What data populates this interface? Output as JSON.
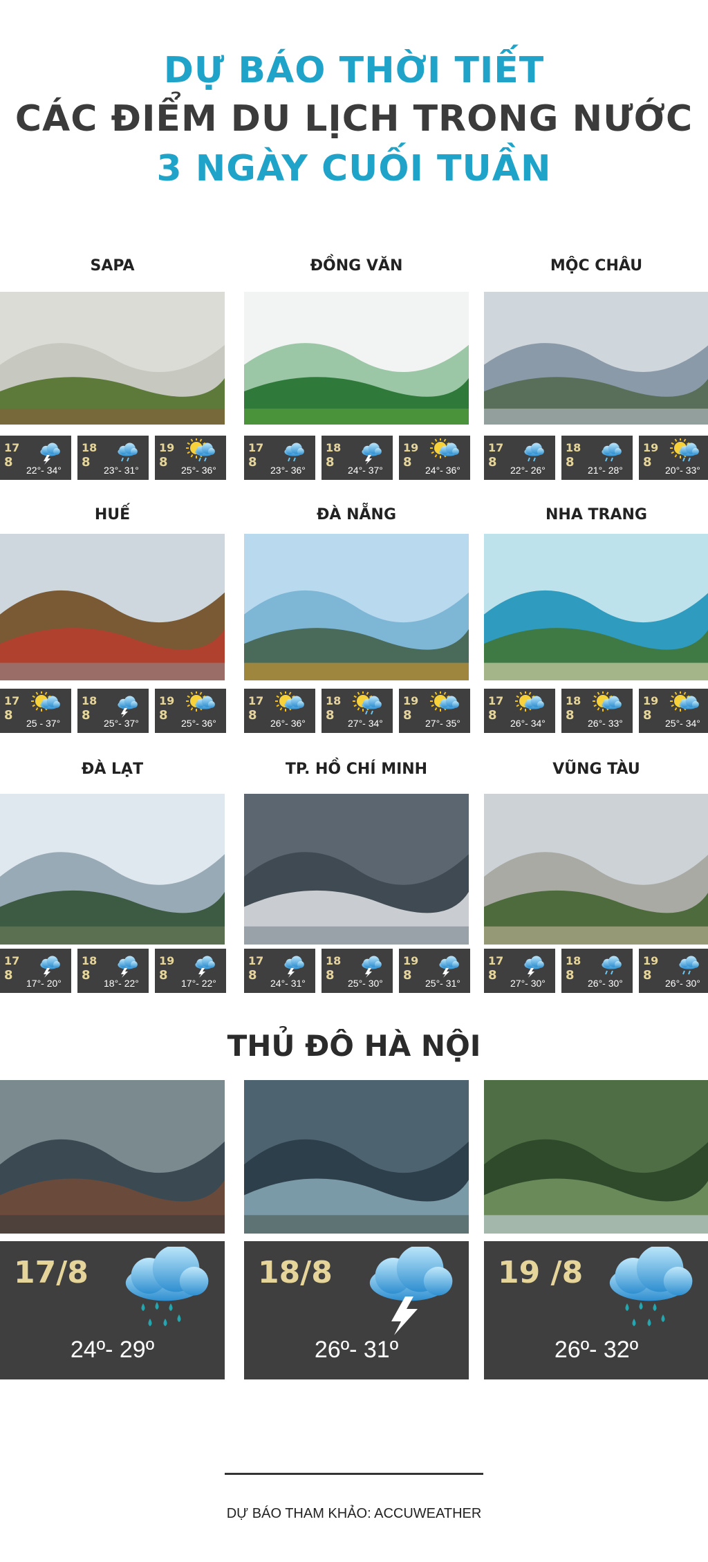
{
  "header": {
    "line1": "DỰ BÁO THỜI TIẾT",
    "line2": "CÁC ĐIỂM DU LỊCH TRONG NƯỚC",
    "line3": "3 NGÀY CUỐI TUẦN"
  },
  "cities": [
    {
      "name": "SAPA",
      "forecast": [
        {
          "day": "17",
          "month": "8",
          "temp": "22°- 34°",
          "icon": "storm-cloud-icon"
        },
        {
          "day": "18",
          "month": "8",
          "temp": "23°- 31°",
          "icon": "rain-cloud-icon"
        },
        {
          "day": "19",
          "month": "8",
          "temp": "25°- 36°",
          "icon": "sun-cloud-rain-icon"
        }
      ]
    },
    {
      "name": "ĐỒNG VĂN",
      "forecast": [
        {
          "day": "17",
          "month": "8",
          "temp": "23°- 36°",
          "icon": "rain-cloud-icon"
        },
        {
          "day": "18",
          "month": "8",
          "temp": "24°- 37°",
          "icon": "storm-cloud-icon"
        },
        {
          "day": "19",
          "month": "8",
          "temp": "24°- 36°",
          "icon": "sun-cloud-icon"
        }
      ]
    },
    {
      "name": "MỘC CHÂU",
      "forecast": [
        {
          "day": "17",
          "month": "8",
          "temp": "22°- 26°",
          "icon": "rain-cloud-icon"
        },
        {
          "day": "18",
          "month": "8",
          "temp": "21°- 28°",
          "icon": "rain-cloud-icon"
        },
        {
          "day": "19",
          "month": "8",
          "temp": "20°- 33°",
          "icon": "sun-cloud-rain-icon"
        }
      ]
    },
    {
      "name": "HUẾ",
      "forecast": [
        {
          "day": "17",
          "month": "8",
          "temp": "25 - 37°",
          "icon": "sun-cloud-icon"
        },
        {
          "day": "18",
          "month": "8",
          "temp": "25°- 37°",
          "icon": "storm-cloud-icon"
        },
        {
          "day": "19",
          "month": "8",
          "temp": "25°- 36°",
          "icon": "sun-cloud-icon"
        }
      ]
    },
    {
      "name": "ĐÀ NẴNG",
      "forecast": [
        {
          "day": "17",
          "month": "8",
          "temp": "26°- 36°",
          "icon": "sun-cloud-icon"
        },
        {
          "day": "18",
          "month": "8",
          "temp": "27°- 34°",
          "icon": "sun-cloud-rain-icon"
        },
        {
          "day": "19",
          "month": "8",
          "temp": "27°- 35°",
          "icon": "sun-cloud-icon"
        }
      ]
    },
    {
      "name": "NHA TRANG",
      "forecast": [
        {
          "day": "17",
          "month": "8",
          "temp": "26°- 34°",
          "icon": "sun-cloud-icon"
        },
        {
          "day": "18",
          "month": "8",
          "temp": "26°- 33°",
          "icon": "sun-cloud-icon"
        },
        {
          "day": "19",
          "month": "8",
          "temp": "25°- 34°",
          "icon": "sun-cloud-icon"
        }
      ]
    },
    {
      "name": "ĐÀ LẠT",
      "forecast": [
        {
          "day": "17",
          "month": "8",
          "temp": "17°- 20°",
          "icon": "storm-cloud-icon"
        },
        {
          "day": "18",
          "month": "8",
          "temp": "18°- 22°",
          "icon": "storm-cloud-icon"
        },
        {
          "day": "19",
          "month": "8",
          "temp": "17°- 22°",
          "icon": "storm-cloud-icon"
        }
      ]
    },
    {
      "name": "TP. HỒ CHÍ MINH",
      "forecast": [
        {
          "day": "17",
          "month": "8",
          "temp": "24°- 31°",
          "icon": "storm-cloud-icon"
        },
        {
          "day": "18",
          "month": "8",
          "temp": "25°- 30°",
          "icon": "storm-cloud-icon"
        },
        {
          "day": "19",
          "month": "8",
          "temp": "25°- 31°",
          "icon": "storm-cloud-icon"
        }
      ]
    },
    {
      "name": "VŨNG TÀU",
      "forecast": [
        {
          "day": "17",
          "month": "8",
          "temp": "27°- 30°",
          "icon": "storm-cloud-icon"
        },
        {
          "day": "18",
          "month": "8",
          "temp": "26°- 30°",
          "icon": "rain-cloud-icon"
        },
        {
          "day": "19",
          "month": "8",
          "temp": "26°- 30°",
          "icon": "rain-cloud-icon"
        }
      ]
    }
  ],
  "hanoi": {
    "title": "THỦ ĐÔ HÀ NỘI",
    "forecast": [
      {
        "date": "17/8",
        "temp": "24º- 29º",
        "icon": "rain-cloud-icon"
      },
      {
        "date": "18/8",
        "temp": "26º- 31º",
        "icon": "storm-cloud-icon"
      },
      {
        "date": "19 /8",
        "temp": "26º- 32º",
        "icon": "rain-cloud-icon"
      }
    ]
  },
  "footer": {
    "source": "DỰ BÁO THAM KHẢO: ACCUWEATHER"
  },
  "colors": {
    "accent": "#1fa3c8",
    "title_dark": "#3b3b3b",
    "panel": "#3f3f3f",
    "date": "#e6d59a"
  }
}
